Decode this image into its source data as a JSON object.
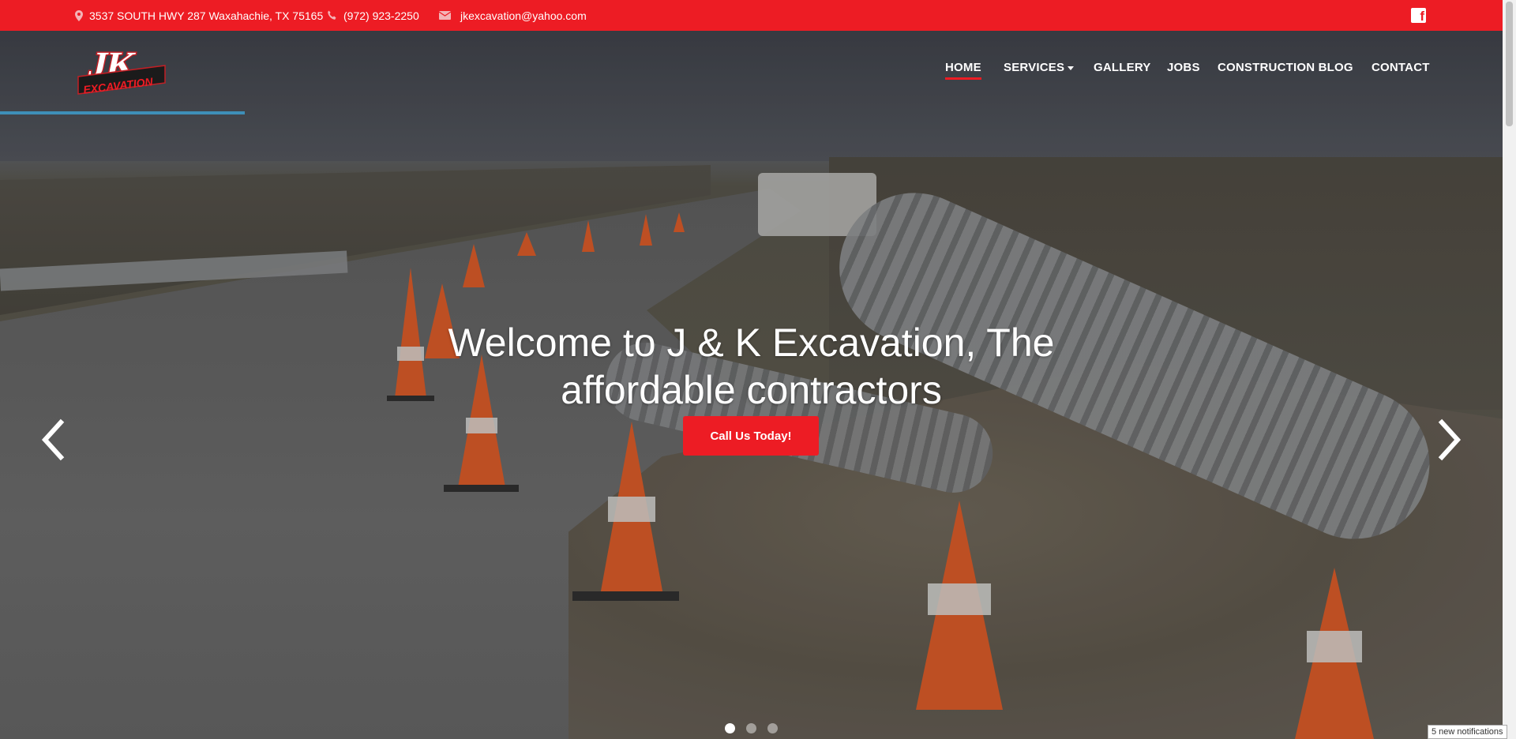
{
  "topbar": {
    "address": "3537 SOUTH HWY 287 Waxahachie, TX 75165",
    "phone": "(972) 923-2250",
    "email": "jkexcavation@yahoo.com",
    "facebook_icon": "f",
    "accent_color": "#ed1c24"
  },
  "logo": {
    "mark": "JK",
    "word": "EXCAVATION"
  },
  "nav": {
    "items": [
      {
        "label": "HOME",
        "active": true
      },
      {
        "label": "SERVICES",
        "dropdown": true
      },
      {
        "label": "GALLERY"
      },
      {
        "label": "JOBS"
      },
      {
        "label": "CONSTRUCTION BLOG"
      },
      {
        "label": "CONTACT"
      }
    ]
  },
  "hero": {
    "headline_line1": "Welcome to J & K Excavation, The",
    "headline_line2": "affordable contractors",
    "cta_label": "Call Us Today!",
    "slide_count": 3,
    "active_slide": 1
  },
  "notification": "5 new notifications"
}
